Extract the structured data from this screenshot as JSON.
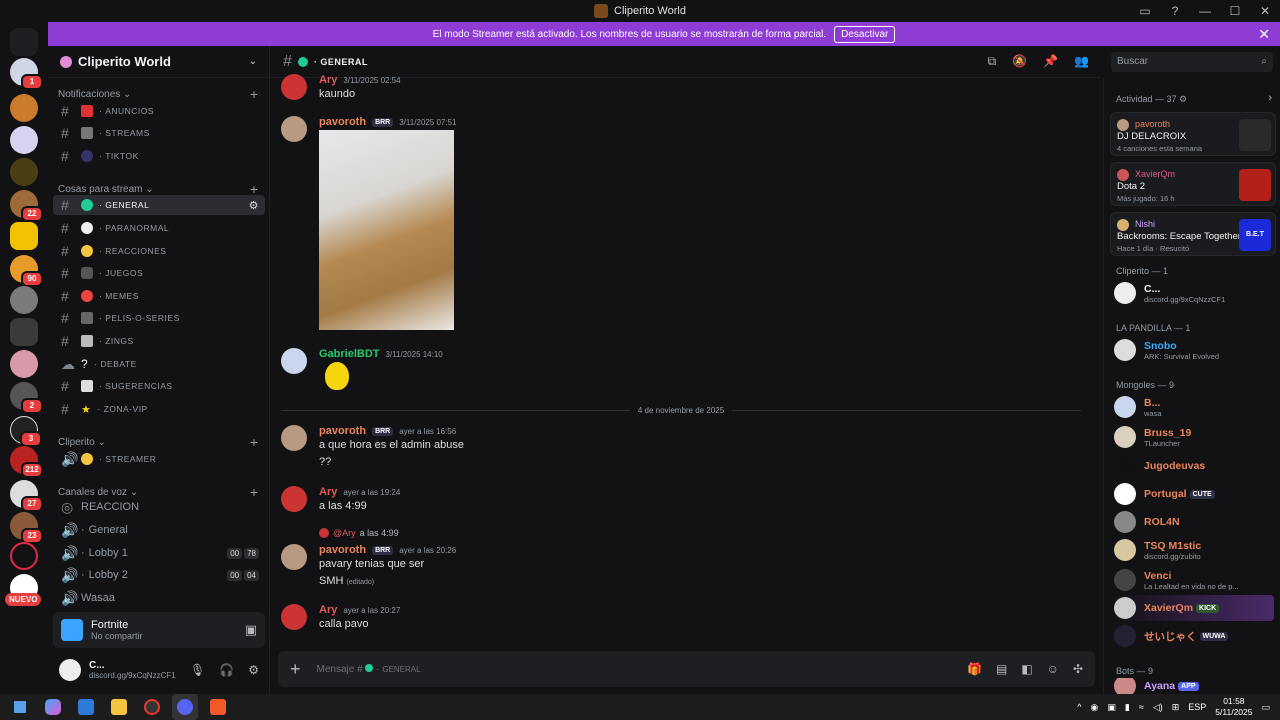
{
  "window": {
    "title": "Cliperito World"
  },
  "streamer_bar": {
    "text": "El modo Streamer está activado. Los nombres de usuario se mostrarán de forma parcial.",
    "button": "Desactivar"
  },
  "guild_badges": {
    "g1": "1",
    "g6": "22",
    "g8": "90",
    "g12": "2",
    "g13": "3",
    "g14": "212",
    "g15": "27",
    "g16": "23",
    "nuevo": "NUEVO"
  },
  "server": {
    "name": "Cliperito World"
  },
  "categories": {
    "notificaciones": "Notificaciones",
    "cosas": "Cosas para stream",
    "cliperito": "Cliperito",
    "voz": "Canales de voz"
  },
  "channels": {
    "anuncios": "ANUNCIOS",
    "streams": "STREAMS",
    "tiktok": "TIKTOK",
    "general": "GENERAL",
    "paranormal": "PARANORMAL",
    "reacciones": "REACCIONES",
    "juegos": "JUEGOS",
    "memes": "MEMES",
    "pelis": "PELIS-O-SERIES",
    "zings": "ZINGS",
    "debate": "DEBATE",
    "sugerencias": "SUGERENCIAS",
    "zona_vip": "ZONA-VIP",
    "streamer": "STREAMER",
    "reaccion_voice": "REACCION",
    "general_voice": "General",
    "lobby1": "Lobby 1",
    "lobby1_a": "00",
    "lobby1_b": "78",
    "lobby2": "Lobby 2",
    "lobby2_a": "00",
    "lobby2_b": "04",
    "wasaa": "Wasaa"
  },
  "game_panel": {
    "name": "Fortnite",
    "sub": "No compartir"
  },
  "user_panel": {
    "name": "C...",
    "status": "discord.gg/9xCqNzzCF1"
  },
  "chat": {
    "channel_name": "GENERAL",
    "search_placeholder": "Buscar",
    "divider": "4 de noviembre de 2025",
    "placeholder": "Mensaje #",
    "placeholder_channel": "GENERAL",
    "messages": [
      {
        "name": "Ary",
        "time": "3/11/2025 02:54",
        "body": "kaundo",
        "color": "#e05a5a"
      },
      {
        "name": "pavoroth",
        "tag": "BRR",
        "time": "3/11/2025 07:51",
        "color": "#e8845a"
      },
      {
        "name": "GabrielBDT",
        "time": "3/11/2025 14:10",
        "color": "#2dc770"
      },
      {
        "name": "pavoroth",
        "tag": "BRR",
        "time": "ayer a las 16:56",
        "body": "a que hora es el admin abuse",
        "body2": "??",
        "color": "#e8845a"
      },
      {
        "name": "Ary",
        "time": "ayer a las 19:24",
        "body": "a las 4:99",
        "color": "#e05a5a"
      },
      {
        "reply_name": "@Ary",
        "reply_text": "a las 4:99",
        "name": "pavoroth",
        "tag": "BRR",
        "time": "ayer a las 20:26",
        "body": "pavary tenias que ser",
        "body2": "SMH",
        "edited": "(editado)",
        "color": "#e8845a"
      },
      {
        "name": "Ary",
        "time": "ayer a las 20:27",
        "body": "calla pavo",
        "color": "#e05a5a"
      }
    ]
  },
  "members": {
    "activity_header": "Actividad — 37",
    "activities": [
      {
        "name": "pavoroth",
        "game": "DJ DELACROIX",
        "sub": "4 canciones esta semana",
        "color": "#e8845a"
      },
      {
        "name": "XavierQm",
        "game": "Dota 2",
        "sub": "Más jugado: 16 h",
        "color": "#e05a8a"
      },
      {
        "name": "Nishi",
        "game": "Backrooms: Escape Together",
        "sub": "Hace 1 día · Resucitó",
        "color": "#c9a0ff",
        "thumb_text": "B.E.T"
      }
    ],
    "groups": {
      "cliperito": "Cliperito — 1",
      "pandilla": "LA PANDILLA — 1",
      "mongoles": "Mongoles — 9",
      "bots": "Bots — 9"
    },
    "list": [
      {
        "name": "C...",
        "sub": "discord.gg/9xCqNzzCF1",
        "color": "#f2f3f5"
      },
      {
        "name": "Snobo",
        "sub": "ARK: Survival Evolved",
        "color": "#3fa9f5"
      },
      {
        "name": "B...",
        "sub": "wasa",
        "color": "#e8845a"
      },
      {
        "name": "Bruss_19",
        "sub": "TLauncher",
        "color": "#e8845a"
      },
      {
        "name": "Jugodeuvas",
        "sub": "",
        "color": "#e8845a"
      },
      {
        "name": "Portugal",
        "tag": "CUTE",
        "sub": "",
        "color": "#e8845a"
      },
      {
        "name": "ROL4N",
        "sub": "",
        "color": "#e8845a"
      },
      {
        "name": "TSQ M1stic",
        "sub": "discord.gg/zubito",
        "color": "#e8845a"
      },
      {
        "name": "Venci",
        "sub": "La Lealtad en vida no de p...",
        "color": "#e8845a"
      },
      {
        "name": "XavierQm",
        "tag": "KICK",
        "sub": "",
        "color": "#e8845a"
      },
      {
        "name": "せいじゃく",
        "tag": "WUWA",
        "sub": "",
        "color": "#e8845a"
      },
      {
        "name": "Ayana",
        "tag": "APP",
        "sub": "",
        "color": "#c9a0ff"
      }
    ]
  },
  "taskbar": {
    "lang": "ESP",
    "time": "01:58",
    "date": "5/11/2025"
  }
}
